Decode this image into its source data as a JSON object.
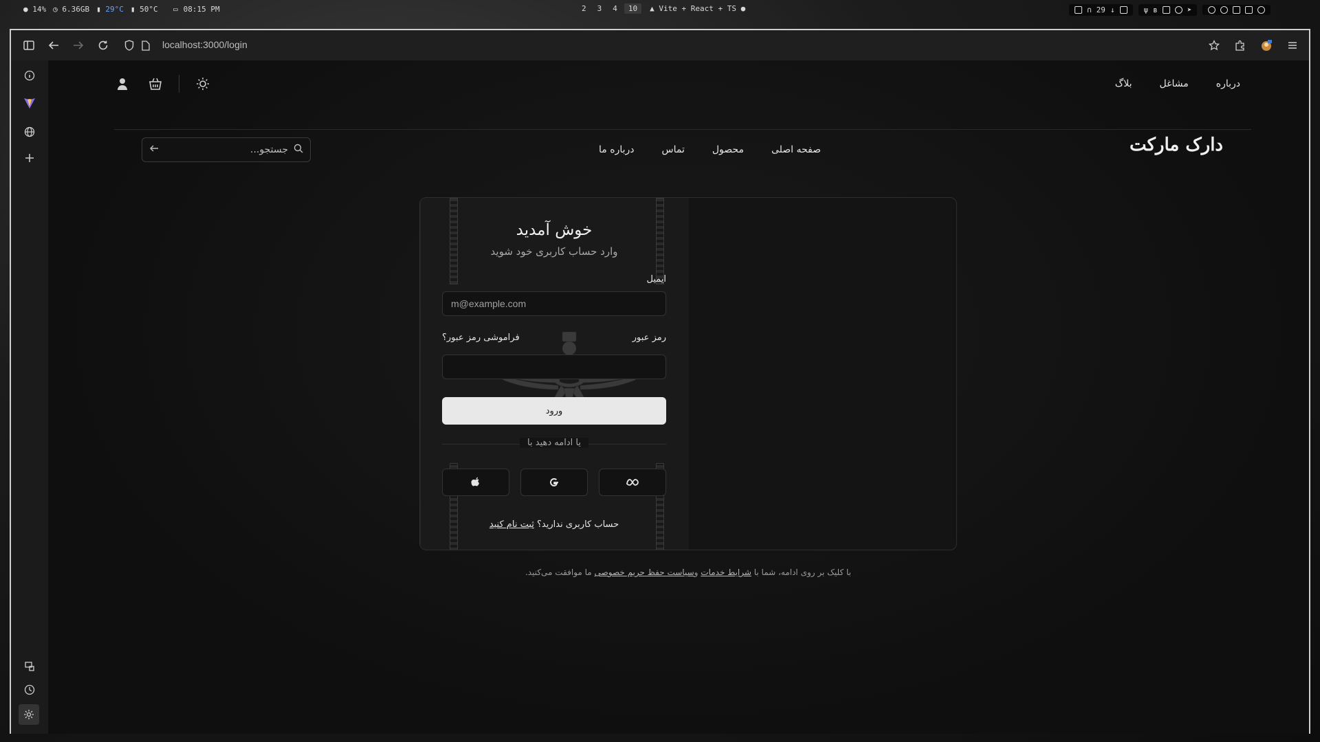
{
  "system_bar": {
    "cpu": "14%",
    "memory": "6.36GB",
    "gpu_temp": "29°C",
    "cpu_temp": "50°C",
    "time": "08:15 PM",
    "workspaces": [
      "2",
      "3",
      "4",
      "10"
    ],
    "active_workspace": "10",
    "window_title": "Vite + React + TS",
    "volume": "29"
  },
  "browser": {
    "url": "localhost:3000/login"
  },
  "header": {
    "top_links": [
      "درباره",
      "مشاغل",
      "بلاگ"
    ],
    "brand": "دارک مارکت",
    "nav_links": [
      "صفحه اصلی",
      "محصول",
      "تماس",
      "درباره ما"
    ],
    "search_placeholder": "جستجو..."
  },
  "login": {
    "title": "خوش آمدید",
    "subtitle": "وارد حساب کاربری خود شوید",
    "email_label": "ایمیل",
    "email_placeholder": "m@example.com",
    "password_label": "رمز عبور",
    "forgot_password": "فراموشی رمز عبور؟",
    "password_value": "",
    "submit_label": "ورود",
    "divider_text": "یا ادامه دهید با",
    "social_buttons": [
      "apple-icon",
      "google-icon",
      "meta-icon"
    ],
    "no_account_text": "حساب کاربری ندارید؟",
    "signup_link": "ثبت نام کنید"
  },
  "terms": {
    "prefix": "با کلیک بر روی ادامه، شما با",
    "terms_link": "شرایط خدمات",
    "conjunction": "و",
    "privacy_link": "سیاست حفظ حریم خصوصی",
    "suffix": "ما موافقت می‌کنید."
  }
}
